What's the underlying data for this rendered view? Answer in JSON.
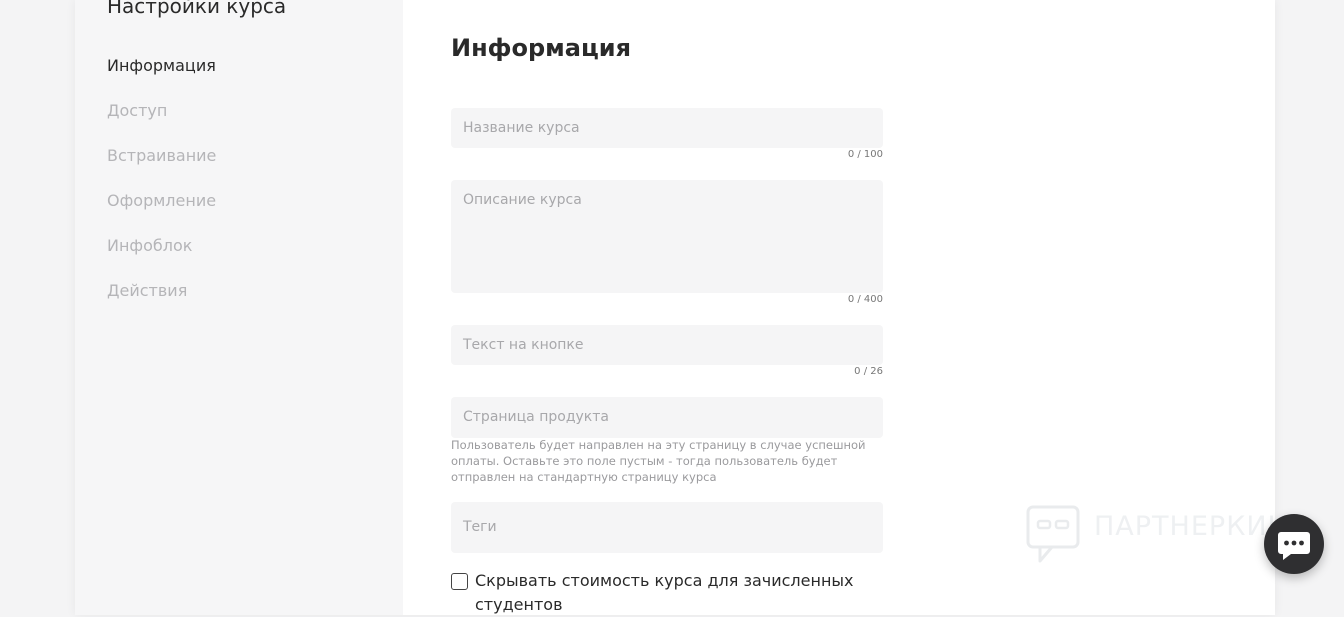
{
  "sidebar": {
    "title": "Настройки курса",
    "items": [
      {
        "label": "Информация",
        "active": true
      },
      {
        "label": "Доступ"
      },
      {
        "label": "Встраивание"
      },
      {
        "label": "Оформление"
      },
      {
        "label": "Инфоблок"
      },
      {
        "label": "Действия"
      }
    ]
  },
  "main": {
    "heading": "Информация",
    "fields": {
      "course_name": {
        "placeholder": "Название курса",
        "value": "",
        "counter": "0 / 100"
      },
      "course_description": {
        "placeholder": "Описание курса",
        "value": "",
        "counter": "0 / 400"
      },
      "button_text": {
        "placeholder": "Текст на кнопке",
        "value": "",
        "counter": "0 / 26"
      },
      "product_page": {
        "placeholder": "Страница продукта",
        "value": "",
        "hint": "Пользователь будет направлен на эту страницу в случае успешной оплаты. Оставьте это поле пустым - тогда пользователь будет отправлен на стандартную страницу курса"
      },
      "tags": {
        "placeholder": "Теги",
        "value": ""
      }
    },
    "hide_price_checkbox": {
      "label": "Скрывать стоимость курса для зачисленных студентов",
      "checked": false
    }
  },
  "watermark": {
    "text": "ПАРТНЕРКИН",
    "icon": "chat-logo-icon"
  },
  "chat_button": {
    "icon": "chat-bubble-icon"
  },
  "colors": {
    "page_bg": "#f4f4f5",
    "sidebar_bg": "#f6f6f7",
    "field_bg": "#f5f5f6",
    "text": "#2a2a2a",
    "muted": "#b5b5b8",
    "chat_bg": "#2f2f31"
  }
}
